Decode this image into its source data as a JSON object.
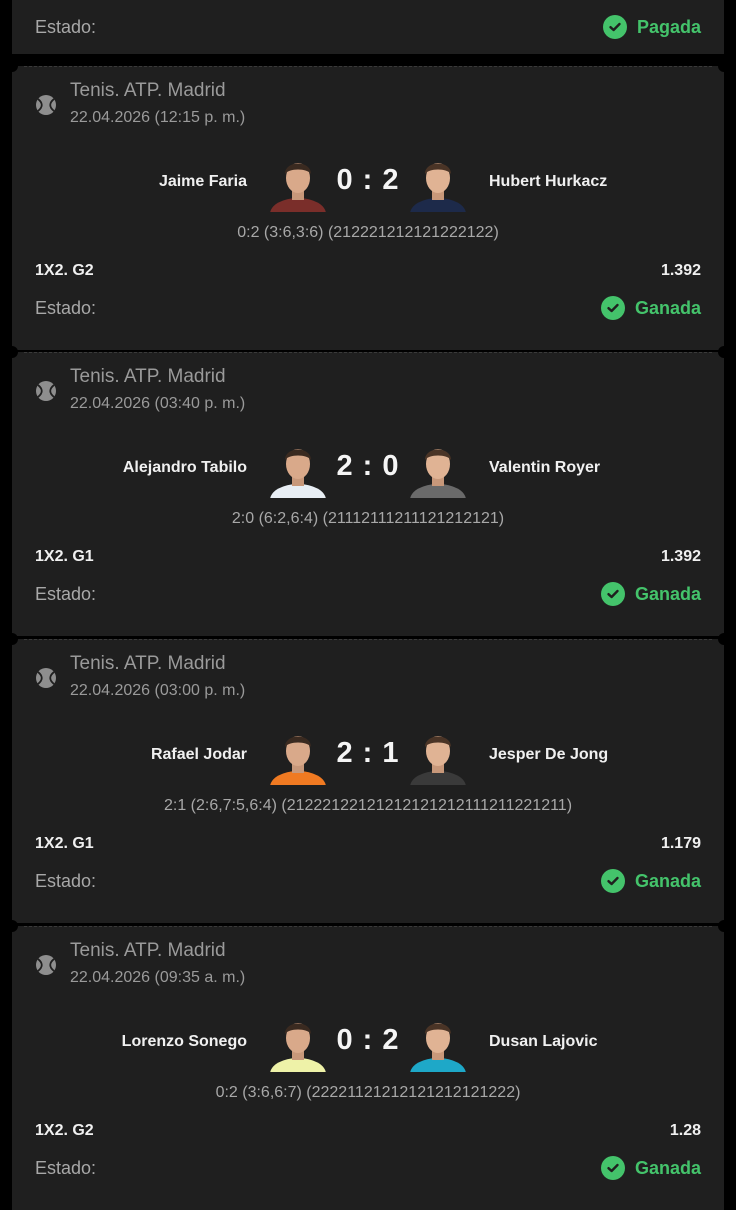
{
  "top": {
    "estado_label": "Estado:",
    "status": "Pagada"
  },
  "matches": [
    {
      "league": "Tenis. ATP. Madrid",
      "date": "22.04.2026 (12:15 p. m.)",
      "player1": "Jaime Faria",
      "player2": "Hubert Hurkacz",
      "score": "0 : 2",
      "detail": "0:2 (3:6,3:6) (212221212121222122)",
      "market": "1X2. G2",
      "odds": "1.392",
      "estado_label": "Estado:",
      "status": "Ganada",
      "p1_shirt": "#7a2e2a",
      "p2_shirt": "#1d2a4a"
    },
    {
      "league": "Tenis. ATP. Madrid",
      "date": "22.04.2026 (03:40 p. m.)",
      "player1": "Alejandro Tabilo",
      "player2": "Valentin Royer",
      "score": "2 : 0",
      "detail": "2:0 (6:2,6:4) (21112111211121212121)",
      "market": "1X2. G1",
      "odds": "1.392",
      "estado_label": "Estado:",
      "status": "Ganada",
      "p1_shirt": "#e8eef4",
      "p2_shirt": "#6a6a6a"
    },
    {
      "league": "Tenis. ATP. Madrid",
      "date": "22.04.2026 (03:00 p. m.)",
      "player1": "Rafael Jodar",
      "player2": "Jesper De Jong",
      "score": "2 : 1",
      "detail": "2:1 (2:6,7:5,6:4) (21222122121212121212111211221211)",
      "market": "1X2. G1",
      "odds": "1.179",
      "estado_label": "Estado:",
      "status": "Ganada",
      "p1_shirt": "#f07a22",
      "p2_shirt": "#3a3a3a"
    },
    {
      "league": "Tenis. ATP. Madrid",
      "date": "22.04.2026 (09:35 a. m.)",
      "player1": "Lorenzo Sonego",
      "player2": "Dusan Lajovic",
      "score": "0 : 2",
      "detail": "0:2 (3:6,6:7) (22221121212121212121222)",
      "market": "1X2. G2",
      "odds": "1.28",
      "estado_label": "Estado:",
      "status": "Ganada",
      "p1_shirt": "#eef2a8",
      "p2_shirt": "#1ea8c8"
    }
  ],
  "colors": {
    "accent_green": "#44c36b",
    "card_bg": "#1f1f1f",
    "page_bg": "#000000"
  }
}
